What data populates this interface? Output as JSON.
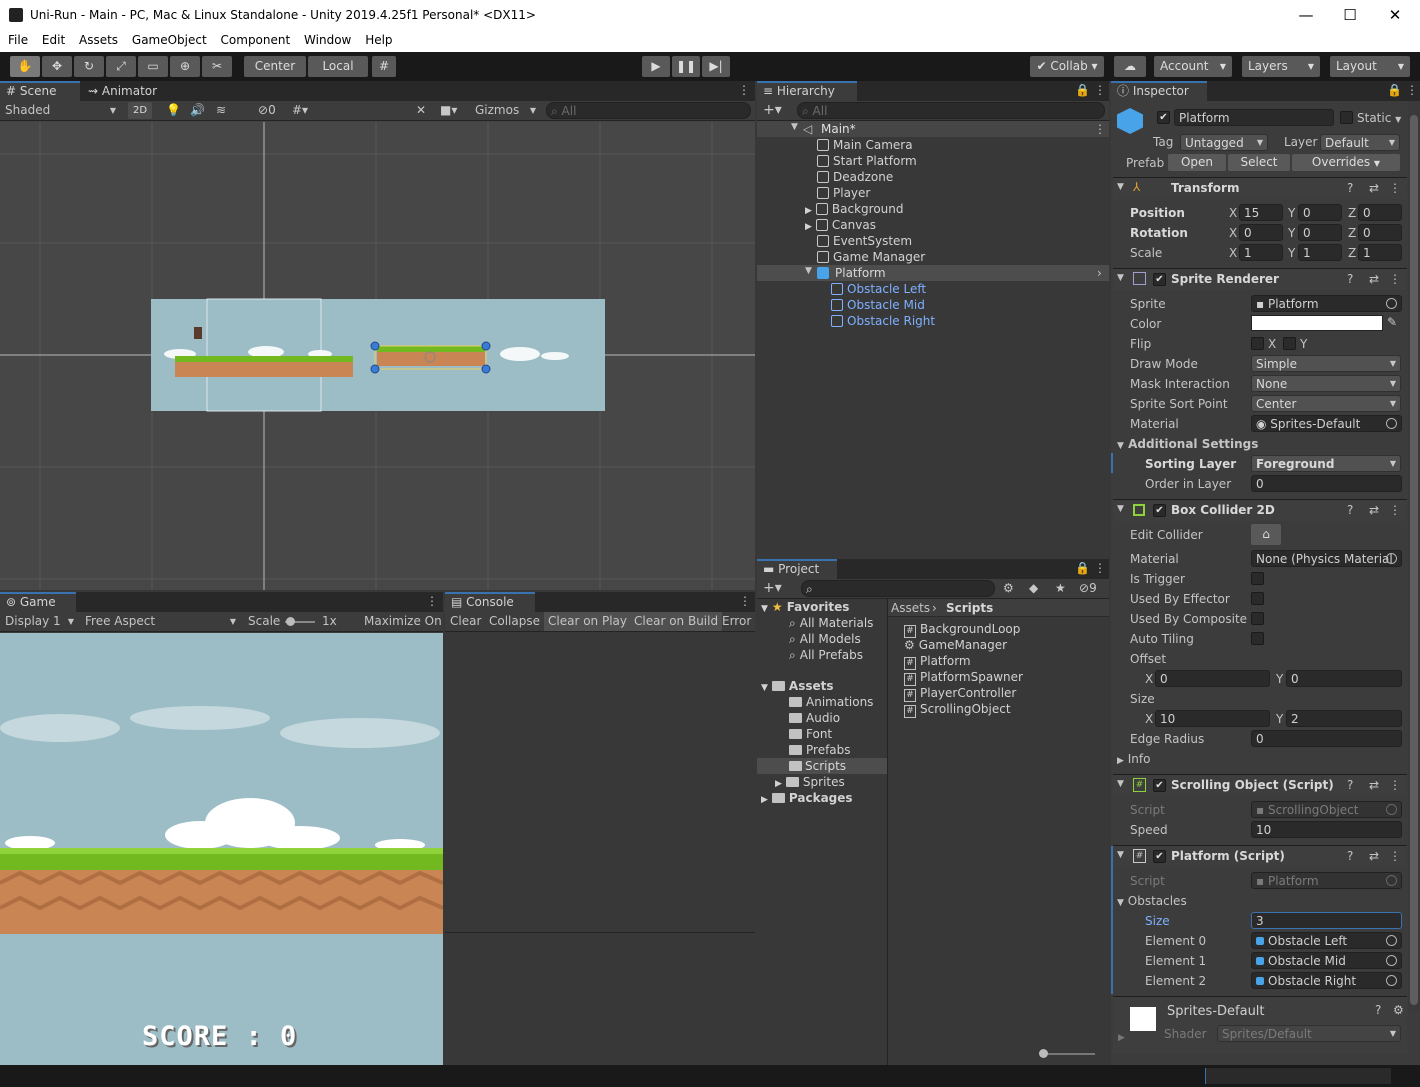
{
  "title": {
    "text": "Uni-Run - Main - PC, Mac & Linux Standalone - Unity 2019.4.25f1 Personal* <DX11>"
  },
  "menu": [
    "File",
    "Edit",
    "Assets",
    "GameObject",
    "Component",
    "Window",
    "Help"
  ],
  "toolbar": {
    "center": "Center",
    "local": "Local",
    "collab": "Collab",
    "account": "Account",
    "layers": "Layers",
    "layout": "Layout"
  },
  "scene": {
    "tab": "Scene",
    "tab2": "Animator",
    "shading": "Shaded",
    "mode2d": "2D",
    "hidden_count": "0",
    "gizmos": "Gizmos",
    "search_placeholder": "All"
  },
  "game": {
    "tab": "Game",
    "display": "Display 1",
    "aspect": "Free Aspect",
    "scale_label": "Scale",
    "scale_value": "1x",
    "maximize": "Maximize On",
    "score": "SCORE : 0"
  },
  "console": {
    "tab": "Console",
    "clear": "Clear",
    "collapse": "Collapse",
    "clear_on_play": "Clear on Play",
    "clear_on_build": "Clear on Build",
    "error_pause": "Error P"
  },
  "hierarchy": {
    "tab": "Hierarchy",
    "search_placeholder": "All",
    "scene": "Main*",
    "items": [
      "Main Camera",
      "Start Platform",
      "Deadzone",
      "Player",
      "Background",
      "Canvas",
      "EventSystem",
      "Game Manager",
      "Platform",
      "Obstacle Left",
      "Obstacle Mid",
      "Obstacle Right"
    ]
  },
  "project": {
    "tab": "Project",
    "hidden_count": "9",
    "favorites": "Favorites",
    "fav_items": [
      "All Materials",
      "All Models",
      "All Prefabs"
    ],
    "assets": "Assets",
    "asset_folders": [
      "Animations",
      "Audio",
      "Font",
      "Prefabs",
      "Scripts",
      "Sprites"
    ],
    "packages": "Packages",
    "breadcrumb": [
      "Assets",
      "Scripts"
    ],
    "files": [
      "BackgroundLoop",
      "GameManager",
      "Platform",
      "PlatformSpawner",
      "PlayerController",
      "ScrollingObject"
    ]
  },
  "inspector": {
    "tab": "Inspector",
    "object_name": "Platform",
    "static": "Static",
    "tag_label": "Tag",
    "tag": "Untagged",
    "layer_label": "Layer",
    "layer": "Default",
    "prefab_label": "Prefab",
    "open": "Open",
    "select": "Select",
    "overrides": "Overrides",
    "transform": {
      "name": "Transform",
      "position": "Position",
      "rotation": "Rotation",
      "scale": "Scale",
      "pos": [
        "15",
        "0",
        "0"
      ],
      "rot": [
        "0",
        "0",
        "0"
      ],
      "scl": [
        "1",
        "1",
        "1"
      ],
      "x": "X",
      "y": "Y",
      "z": "Z"
    },
    "sprite_renderer": {
      "name": "Sprite Renderer",
      "sprite_label": "Sprite",
      "sprite": "Platform",
      "color_label": "Color",
      "flip_label": "Flip",
      "draw_mode_label": "Draw Mode",
      "draw_mode": "Simple",
      "mask_label": "Mask Interaction",
      "mask": "None",
      "sort_point_label": "Sprite Sort Point",
      "sort_point": "Center",
      "material_label": "Material",
      "material": "Sprites-Default",
      "additional": "Additional Settings",
      "sorting_layer_label": "Sorting Layer",
      "sorting_layer": "Foreground",
      "order_label": "Order in Layer",
      "order": "0"
    },
    "box_collider": {
      "name": "Box Collider 2D",
      "edit_label": "Edit Collider",
      "material_label": "Material",
      "material": "None (Physics Material",
      "trigger": "Is Trigger",
      "effector": "Used By Effector",
      "composite": "Used By Composite",
      "tiling": "Auto Tiling",
      "offset_label": "Offset",
      "offset": [
        "0",
        "0"
      ],
      "size_label": "Size",
      "size": [
        "10",
        "2"
      ],
      "edge_label": "Edge Radius",
      "edge": "0",
      "info": "Info"
    },
    "scrolling": {
      "name": "Scrolling Object (Script)",
      "script_label": "Script",
      "script": "ScrollingObject",
      "speed_label": "Speed",
      "speed": "10"
    },
    "platform": {
      "name": "Platform (Script)",
      "script_label": "Script",
      "script": "Platform",
      "obstacles": "Obstacles",
      "size_label": "Size",
      "size": "3",
      "elements": [
        {
          "label": "Element 0",
          "value": "Obstacle Left"
        },
        {
          "label": "Element 1",
          "value": "Obstacle Mid"
        },
        {
          "label": "Element 2",
          "value": "Obstacle Right"
        }
      ]
    },
    "material_preview": {
      "name": "Sprites-Default",
      "shader_label": "Shader",
      "shader": "Sprites/Default"
    }
  },
  "colors": {
    "sky": "#9dbdc6",
    "grass": "#72b81f",
    "dirt": "#c98553",
    "accent": "#3a72b0",
    "link": "#7fb0ff"
  }
}
